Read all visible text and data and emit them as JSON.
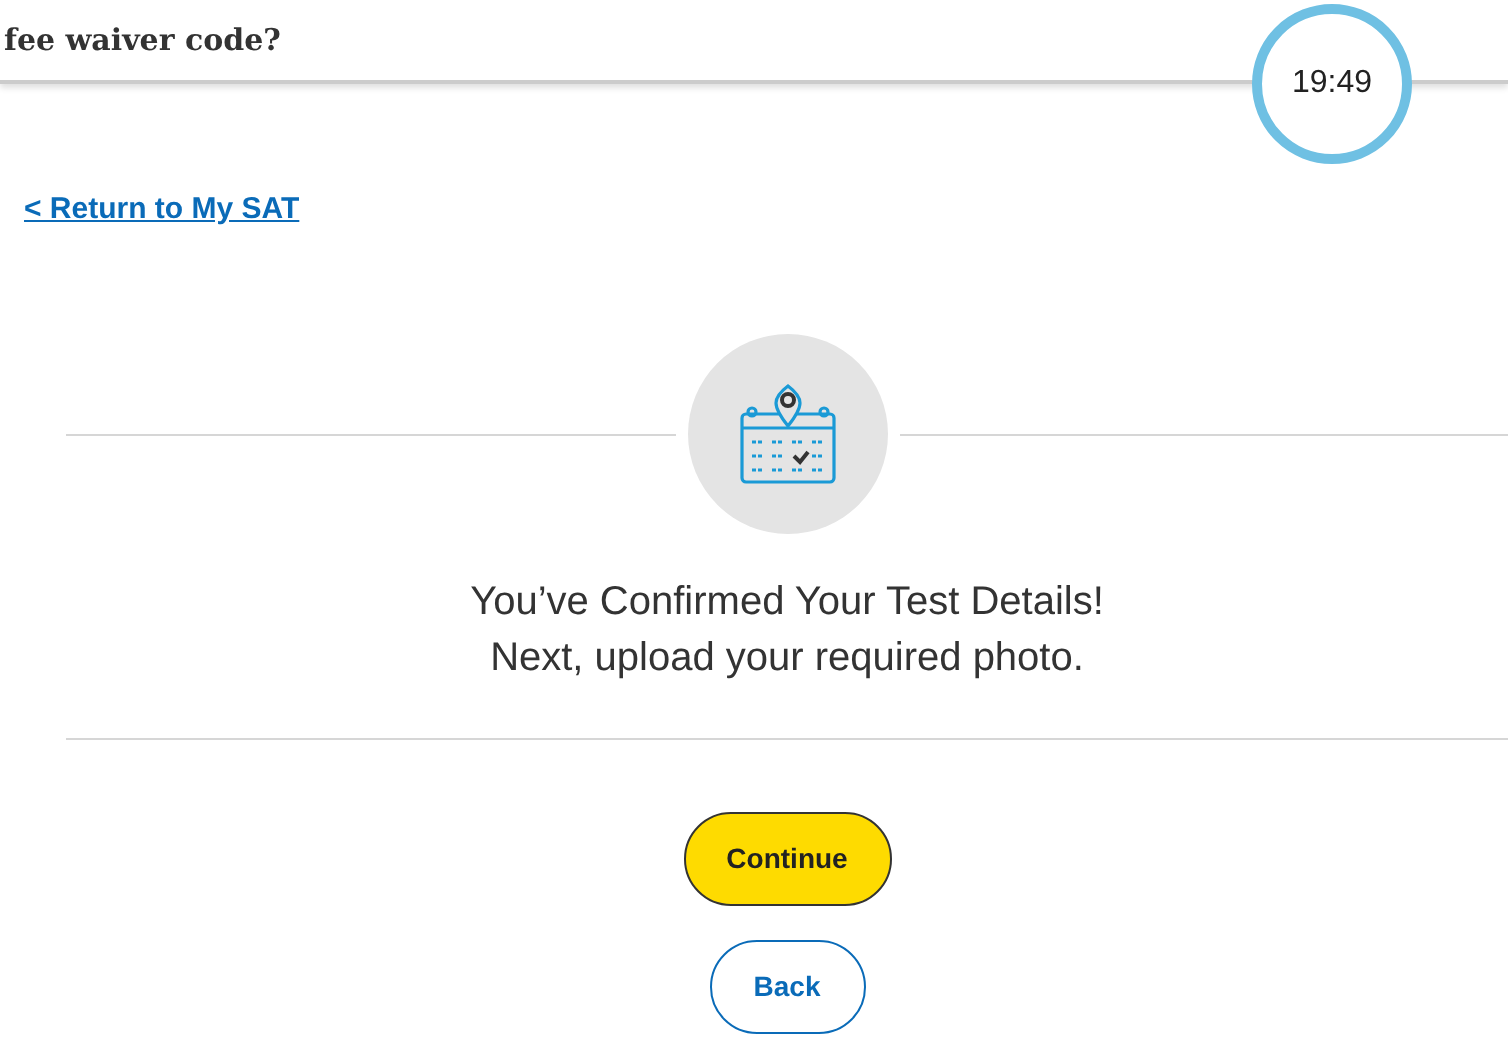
{
  "header": {
    "question": "fee waiver code?",
    "timer": "19:49"
  },
  "back_link": "< Return to My SAT",
  "confirmation": {
    "title": "You’ve Confirmed Your Test Details!",
    "subtitle": "Next, upload your required photo."
  },
  "buttons": [
    {
      "label": "Continue",
      "kind": "primary"
    },
    {
      "label": "Back",
      "kind": "secondary"
    }
  ]
}
